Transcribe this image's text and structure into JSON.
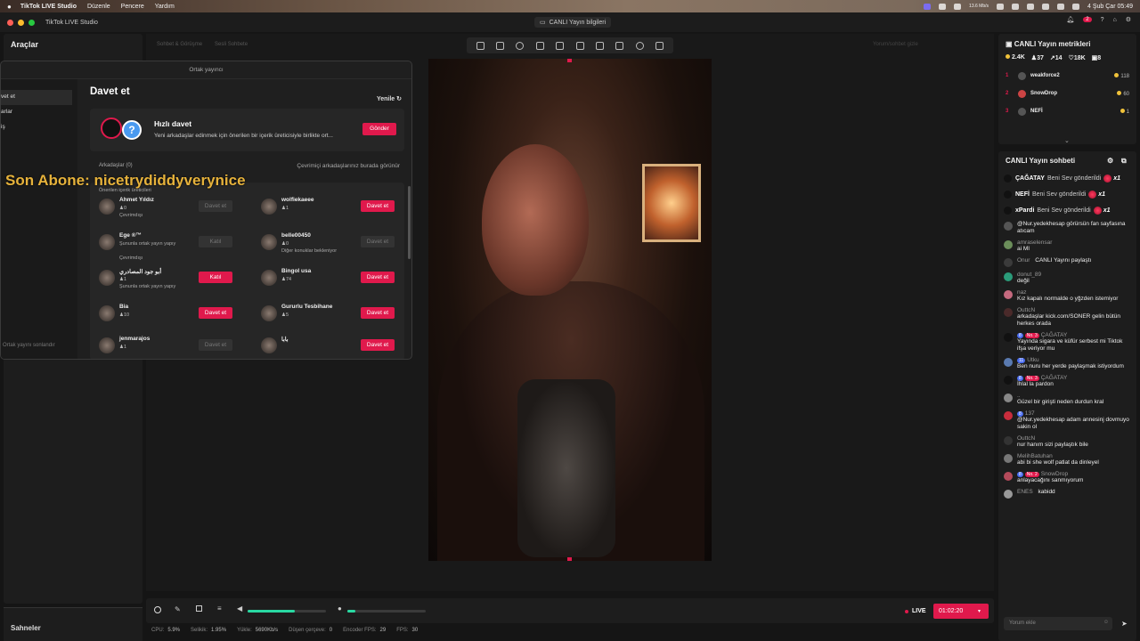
{
  "menubar": {
    "app": "TikTok LIVE Studio",
    "items": [
      "Düzenle",
      "Pencere",
      "Yardım"
    ],
    "datetime": "4 Şub Çar 05:49",
    "net": "13.6 Mb/s"
  },
  "titlebar": {
    "app_title": "TikTok LIVE Studio",
    "center": "CANLI Yayın bilgileri",
    "notif_count": "2"
  },
  "left": {
    "tools_title": "Araçlar",
    "scenes_title": "Sahneler"
  },
  "canvas": {
    "faded1": "Sohbet & Görüşme",
    "faded2": "Sesli Sohbete",
    "faded3": "Yorum/sohbet gizle"
  },
  "dialog": {
    "window_title": "Ortak yayıncı",
    "nav": [
      "vet et",
      "arlar",
      "iş"
    ],
    "nav_end": "Ortak yayını sonlandır",
    "heading": "Davet et",
    "refresh": "Yenile",
    "quick_title": "Hızlı davet",
    "quick_desc": "Yeni arkadaşlar edinmek için önerilen bir içerik üreticisiyle birlikte ort...",
    "send": "Gönder",
    "friends": "Arkadaşlar (0)",
    "friends_right": "Çevrimiçi arkadaşlarınız burada görünür",
    "suggested": "Önerilen içerik üreticileri",
    "creators_left": [
      {
        "name": "Ahmet Yıldız",
        "count": "0",
        "status": "Çevrimdışı",
        "btn": "Davet et",
        "disabled": true
      },
      {
        "name": "Ege ®™",
        "count": "",
        "status": "Şununla ortak yayın yapıy",
        "status2": "Çevrimdışı",
        "btn": "Katıl",
        "disabled": true
      },
      {
        "name": "أبو جود المصادري",
        "count": "1",
        "status": "Şununla ortak yayın yapıy",
        "btn": "Katıl",
        "disabled": false
      },
      {
        "name": "Bia",
        "count": "10",
        "status": "",
        "btn": "Davet et",
        "disabled": false
      },
      {
        "name": "jenmarajos",
        "count": "1",
        "status": "",
        "btn": "Davet et",
        "disabled": true
      }
    ],
    "creators_right": [
      {
        "name": "wolfiekaeee",
        "count": "1",
        "status": "",
        "btn": "Davet et",
        "disabled": false
      },
      {
        "name": "belle00450",
        "count": "0",
        "status": "Diğer konuklar bekleniyor",
        "btn": "Davet et",
        "disabled": true
      },
      {
        "name": "Bingol usa",
        "count": "74",
        "status": "",
        "btn": "Davet et",
        "disabled": false
      },
      {
        "name": "Gururlu Tesbihane",
        "count": "5",
        "status": "",
        "btn": "Davet et",
        "disabled": false
      },
      {
        "name": "بابا",
        "count": "",
        "status": "",
        "btn": "Davet et",
        "disabled": false
      }
    ]
  },
  "overlay_text": "Son Abone: nicetrydiddyverynice",
  "controls": {
    "live": "LIVE",
    "time": "01:02:20",
    "status": [
      {
        "label": "CPU:",
        "value": "5.9%"
      },
      {
        "label": "Selikik:",
        "value": "1.95%"
      },
      {
        "label": "Yükle:",
        "value": "5690Kb/s"
      },
      {
        "label": "Düşen çerçeve:",
        "value": "0"
      },
      {
        "label": "Encoder FPS:",
        "value": "29"
      },
      {
        "label": "FPS:",
        "value": "30"
      }
    ],
    "volume": 0.6,
    "mic": 0.1
  },
  "metrics": {
    "title": "CANLI Yayın metrikleri",
    "stats": [
      {
        "icon": "viewers-icon",
        "value": "2.4K"
      },
      {
        "icon": "users-icon",
        "value": "37"
      },
      {
        "icon": "share-icon",
        "value": "14"
      },
      {
        "icon": "heart-icon",
        "value": "18K"
      },
      {
        "icon": "gift-icon",
        "value": "8"
      }
    ],
    "ranking": [
      {
        "rank": "1",
        "name": "weakforce2",
        "points": "118"
      },
      {
        "rank": "2",
        "name": "SnowDrop",
        "points": "60"
      },
      {
        "rank": "3",
        "name": "NEFİ",
        "points": "1"
      }
    ]
  },
  "chat": {
    "title": "CANLI Yayın sohbeti",
    "gifts": [
      {
        "user": "ÇAĞATAY",
        "text": "Beni Sev gönderildi",
        "mult": "x1"
      },
      {
        "user": "NEFİ",
        "text": "Beni Sev gönderildi",
        "mult": "x1"
      },
      {
        "user": "xPardi",
        "text": "Beni Sev gönderildi",
        "mult": "x1"
      }
    ],
    "messages": [
      {
        "user": "",
        "text": "@Nur.yedekhesap görürsün fan sayfasına atıcam"
      },
      {
        "user": "amraselensar",
        "text": "ai MI"
      },
      {
        "user": "Onur",
        "text": "CANLI Yayını paylaştı",
        "inline": true
      },
      {
        "user": "donut_89",
        "text": "değil"
      },
      {
        "user": "naz",
        "text": "Kız kapalı normalde o yğzden istemiyor"
      },
      {
        "user": "OuttcN",
        "text": "arkadaşlar kick.com/SONER gelin bütün herkes orada"
      },
      {
        "user": "ÇAĞATAY",
        "badge": "8",
        "rank": "No. 3",
        "text": "Yayında sigara ve küfür serbest mi Tiktok ifşa veriyor mu"
      },
      {
        "user": "Utku",
        "badge": "11",
        "text": "Ben nuru her yerde paylaşmak istiyordum"
      },
      {
        "user": "ÇAĞATAY",
        "badge": "8",
        "rank": "No. 3",
        "text": "İhlal la pardon"
      },
      {
        "user": "..",
        "text": "Güzel bir girişti neden durdun kral"
      },
      {
        "user": "137",
        "badge": "8",
        "text": "@Nur.yedekhesap adam annesinj dovmuyo sakin ol"
      },
      {
        "user": "OuttcN",
        "text": "nur hanım sizi paylaştık bile"
      },
      {
        "user": "MelihBatuhan",
        "text": "abi bi she wolf patlat da dinleyel"
      },
      {
        "user": "SnowDrop",
        "badge": "8",
        "rank": "No. 2",
        "text": "anlayacağını sanmıyorum"
      },
      {
        "user": "ENES",
        "text": "kabidd",
        "inline": true
      }
    ],
    "input_placeholder": "Yorum ekle"
  }
}
